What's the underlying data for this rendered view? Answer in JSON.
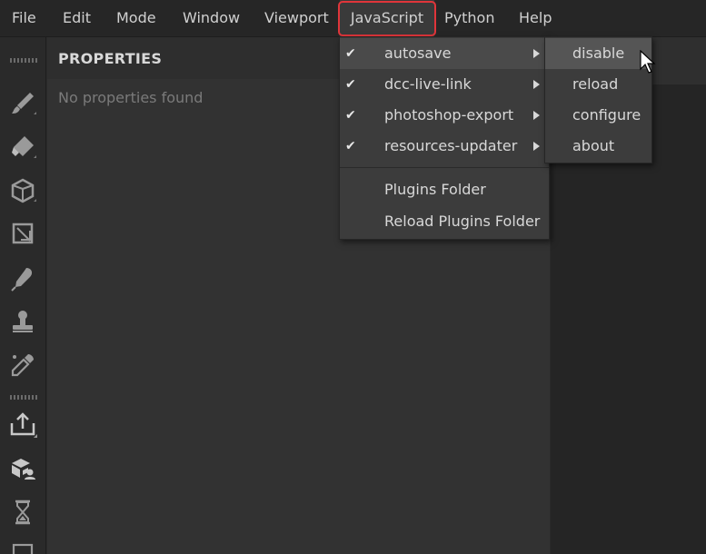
{
  "menubar": {
    "items": [
      {
        "label": "File"
      },
      {
        "label": "Edit"
      },
      {
        "label": "Mode"
      },
      {
        "label": "Window"
      },
      {
        "label": "Viewport"
      },
      {
        "label": "JavaScript",
        "active": true
      },
      {
        "label": "Python"
      },
      {
        "label": "Help"
      }
    ]
  },
  "properties": {
    "title": "PROPERTIES",
    "empty_text": "No properties found"
  },
  "javascript_menu": {
    "plugins": [
      {
        "label": "autosave",
        "checked": true
      },
      {
        "label": "dcc-live-link",
        "checked": true
      },
      {
        "label": "photoshop-export",
        "checked": true
      },
      {
        "label": "resources-updater",
        "checked": true
      }
    ],
    "actions": [
      {
        "label": "Plugins Folder"
      },
      {
        "label": "Reload Plugins Folder"
      }
    ],
    "check_glyph": "✔"
  },
  "autosave_submenu": {
    "items": [
      {
        "label": "disable"
      },
      {
        "label": "reload"
      },
      {
        "label": "configure"
      },
      {
        "label": "about"
      }
    ]
  },
  "toolbar": {
    "icons": [
      "paint-brush-icon",
      "eraser-icon",
      "projection-icon",
      "polygon-fill-icon",
      "smudge-icon",
      "clone-stamp-icon",
      "color-picker-icon",
      "export-icon",
      "bake-icon",
      "history-icon"
    ]
  },
  "colors": {
    "highlight_border": "#e0353a",
    "background": "#2b2b2b",
    "menu_bg": "#3c3c3c"
  }
}
